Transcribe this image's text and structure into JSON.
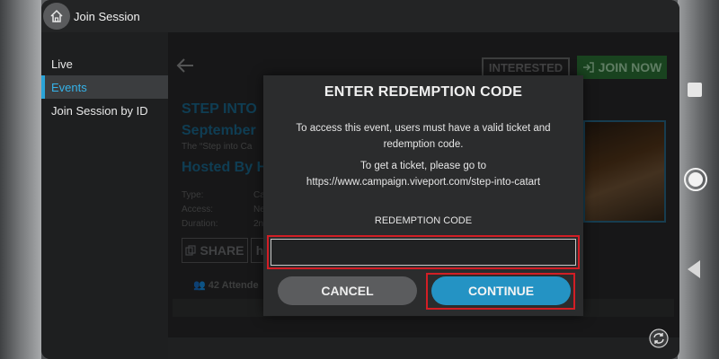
{
  "window": {
    "title": "Join Session",
    "home_icon": "home-icon"
  },
  "sidebar": {
    "items": [
      {
        "label": "Live",
        "active": false
      },
      {
        "label": "Events",
        "active": true
      },
      {
        "label": "Join Session by ID",
        "active": false
      }
    ],
    "accent": "#2aa4d8"
  },
  "event": {
    "back_icon": "back-arrow-icon",
    "interested_label": "INTERESTED",
    "join_label": "JOIN NOW",
    "title_line1": "STEP INTO",
    "title_line2": "September",
    "desc": "The “Step into Ca",
    "host": "Hosted By H",
    "meta": [
      {
        "label": "Type:",
        "value": "Ca"
      },
      {
        "label": "Access:",
        "value": "Ne"
      },
      {
        "label": "Duration:",
        "value": "2n"
      }
    ],
    "share_label": "SHARE",
    "h_label": "h",
    "attendees": "42 Attende"
  },
  "modal": {
    "title": "ENTER REDEMPTION CODE",
    "text1": "To access this event, users must have a valid ticket and redemption code.",
    "text2_line1": "To get a ticket, please go to",
    "text2_line2": "https://www.campaign.viveport.com/step-into-catart",
    "code_label": "REDEMPTION CODE",
    "code_value": "",
    "cancel_label": "CANCEL",
    "continue_label": "CONTINUE",
    "highlight_color": "#d21e25",
    "continue_color": "#2493c4"
  },
  "colors": {
    "join_bg": "#2f7a3a",
    "panel_bg": "#1f2021"
  }
}
